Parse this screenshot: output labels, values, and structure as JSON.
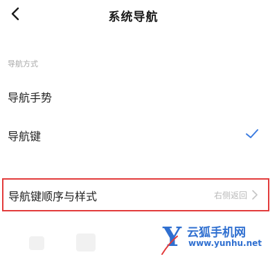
{
  "header": {
    "title": "系统导航",
    "back_icon": "chevron-left-icon"
  },
  "section": {
    "label": "导航方式"
  },
  "options": [
    {
      "label": "导航手势",
      "selected": false
    },
    {
      "label": "导航键",
      "selected": true,
      "check_icon": "checkmark-icon"
    }
  ],
  "order_row": {
    "label": "导航键顺序与样式",
    "value": "右侧返回",
    "chevron_icon": "chevron-right-icon",
    "highlight_color": "#e23a3a"
  },
  "watermark": {
    "name": "云狐手机网",
    "url": "www.yunhu.net",
    "color": "#2f6fd0"
  },
  "colors": {
    "accent": "#3b7be0",
    "text_primary": "#222222",
    "text_secondary": "#a8a8a8"
  }
}
